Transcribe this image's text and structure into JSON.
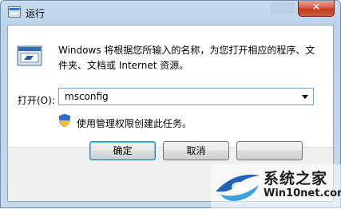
{
  "window": {
    "title": "运行"
  },
  "dialog": {
    "description": "Windows 将根据您所输入的名称，为您打开相应的程序、文件夹、文档或 Internet 资源。",
    "open_label": "打开(O):",
    "open_value": "msconfig",
    "admin_note": "使用管理权限创建此任务。"
  },
  "buttons": {
    "ok": "确定",
    "cancel": "取消",
    "browse": ""
  },
  "watermark": {
    "line1": "系统之家",
    "line2": "Win10net.com"
  },
  "icons": [
    "run-icon",
    "shield-icon",
    "dropdown-arrow-icon",
    "close-icon",
    "app-icon"
  ],
  "colors": {
    "close_button": "#c33a21",
    "ok_focus": "#48d3f7",
    "client_bg": "#ffffff"
  }
}
